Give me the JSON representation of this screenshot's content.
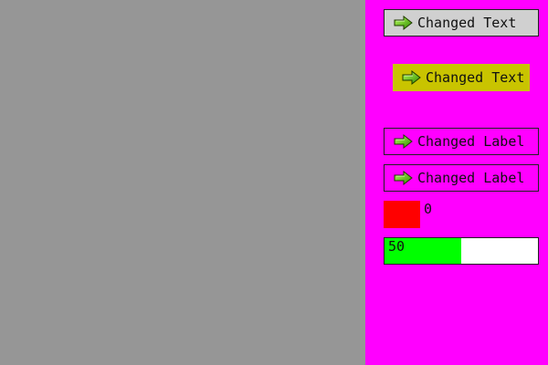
{
  "colors": {
    "left_background": "#969696",
    "right_background": "#ff00ff",
    "button_1_background": "#d0d0d0",
    "button_2_background": "#c9c400",
    "swatch_color": "#ff0000",
    "progress_fill_color": "#00ff00",
    "progress_track_color": "#ffffff"
  },
  "controls": {
    "button_1": {
      "label": "Changed Text",
      "icon": "arrow-right-icon"
    },
    "button_2": {
      "label": "Changed Text",
      "icon": "arrow-right-icon"
    },
    "button_3": {
      "label": "Changed Label",
      "icon": "arrow-right-icon"
    },
    "button_4": {
      "label": "Changed Label",
      "icon": "arrow-right-icon"
    },
    "swatch": {
      "value_text": "0"
    },
    "progress": {
      "value": 50,
      "max": 100,
      "value_text": "50"
    }
  }
}
